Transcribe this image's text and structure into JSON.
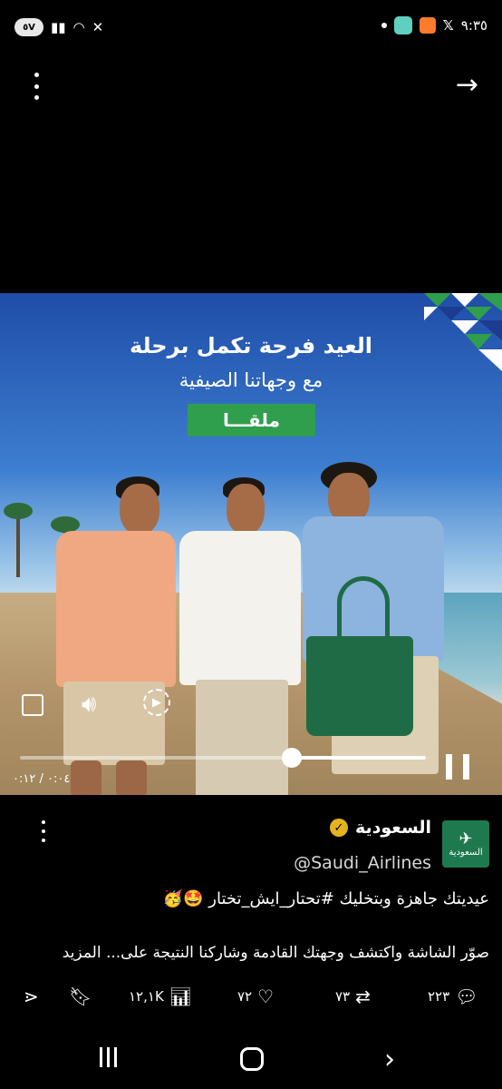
{
  "status_bar": {
    "time": "٩:٣٥",
    "battery": "٥V",
    "notification_apps": [
      "app-badge-icon",
      "app-badge-orange-icon",
      "x-icon"
    ]
  },
  "top_bar": {
    "icons": [
      "more-vertical-icon",
      "arrow-right-icon"
    ]
  },
  "video": {
    "headline": "العيد فرحة تكمل برحلة",
    "subheadline": "مع وجهاتنا الصيفية",
    "destination": "ملقـــا",
    "time_display": "٠:٠٤ / ٠:١٢",
    "progress": 0.33,
    "controls": [
      "fullscreen-icon",
      "volume-icon",
      "replay-icon",
      "pause-icon"
    ],
    "colors": {
      "sky": "#2f63b8",
      "banner": "#2f9e4d",
      "bag": "#1f6b45"
    }
  },
  "tweet": {
    "display_name": "السعودية",
    "handle": "@Saudi_Airlines",
    "avatar_text": "السعودية",
    "line1": "عيديتك جاهزة وبتخليك #تحتار_ايش_تختار 🤩🥳",
    "line2": "صوّر الشاشة واكتشف وجهتك القادمة وشاركنا النتيجة على... ",
    "more_label": "المزيد"
  },
  "actions": {
    "replies": "٢٢٣",
    "retweets": "٧٣",
    "likes": "٧٢",
    "views": "١٢,١K"
  },
  "nav": {
    "icons": [
      "recents-icon",
      "home-icon",
      "back-icon"
    ]
  }
}
